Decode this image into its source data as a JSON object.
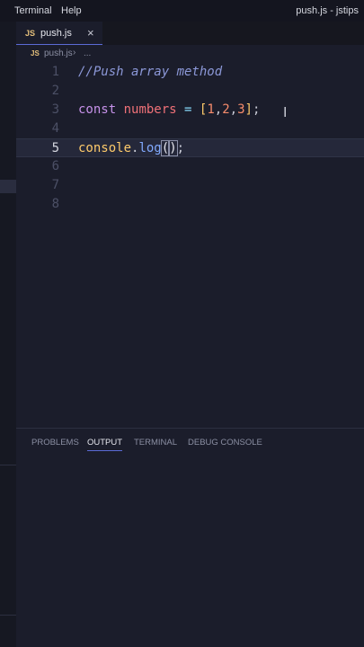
{
  "menu": {
    "terminal": "Terminal",
    "help": "Help"
  },
  "window_title": "push.js - jstips",
  "tab": {
    "icon_text": "JS",
    "label": "push.js",
    "close": "×"
  },
  "breadcrumb": {
    "icon_text": "JS",
    "file": "push.js",
    "separator": "›",
    "more": "..."
  },
  "editor": {
    "line_numbers": [
      "1",
      "2",
      "3",
      "4",
      "5",
      "6",
      "7",
      "8"
    ],
    "active_line": "5",
    "line1": {
      "comment": "//Push array method"
    },
    "line3": {
      "keyword": "const",
      "var": "numbers",
      "op": "=",
      "open": "[",
      "n1": "1",
      "c1": ",",
      "n2": "2",
      "c2": ",",
      "n3": "3",
      "close": "]",
      "semi": ";"
    },
    "line5": {
      "obj": "console",
      "dot": ".",
      "fn": "log",
      "paren_open": "(",
      "paren_close": ")",
      "semi": ";"
    }
  },
  "panel": {
    "tabs": [
      "PROBLEMS",
      "OUTPUT",
      "TERMINAL",
      "DEBUG CONSOLE"
    ],
    "active_tab": "OUTPUT"
  },
  "colors": {
    "background": "#1b1d2b",
    "accent": "#5b6bd6",
    "comment": "#8c98d8",
    "keyword": "#c792ea",
    "variable": "#f07178",
    "number": "#f78c6c",
    "js_icon": "#e5c07b"
  },
  "icons": {
    "ibeam": "text-cursor-icon",
    "close": "close-icon",
    "js": "js-file-icon"
  }
}
